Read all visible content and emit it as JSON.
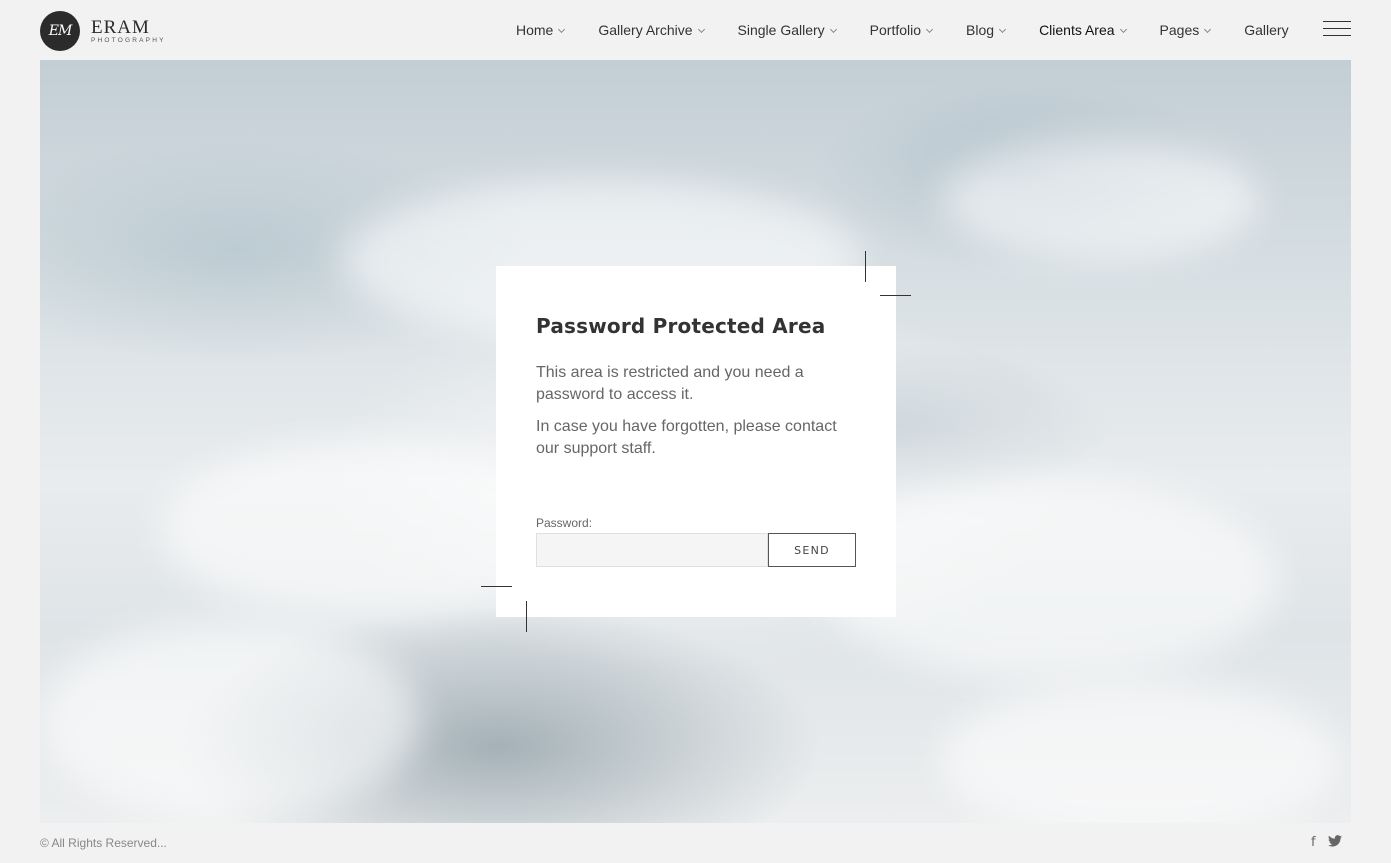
{
  "logo": {
    "monogram": "EM",
    "name": "ERAM",
    "subtitle": "PHOTOGRAPHY"
  },
  "nav": {
    "items": [
      {
        "label": "Home",
        "has_dropdown": true
      },
      {
        "label": "Gallery Archive",
        "has_dropdown": true
      },
      {
        "label": "Single Gallery",
        "has_dropdown": true
      },
      {
        "label": "Portfolio",
        "has_dropdown": true
      },
      {
        "label": "Blog",
        "has_dropdown": true
      },
      {
        "label": "Clients Area",
        "has_dropdown": true,
        "active": true
      },
      {
        "label": "Pages",
        "has_dropdown": true
      },
      {
        "label": "Gallery",
        "has_dropdown": false
      }
    ],
    "menu_icon": "hamburger-icon"
  },
  "card": {
    "title": "Password Protected Area",
    "paragraph1": "This area is restricted and you need a password to access it.",
    "paragraph2": "In case you have forgotten, please contact our support staff.",
    "password_label": "Password:",
    "password_value": "",
    "send_label": "SEND"
  },
  "footer": {
    "copyright": "© All Rights Reserved...",
    "social": [
      "facebook-icon",
      "twitter-icon"
    ]
  },
  "colors": {
    "background": "#f2f2f2",
    "text": "#333333",
    "logo_circle": "#2b2b2b"
  }
}
